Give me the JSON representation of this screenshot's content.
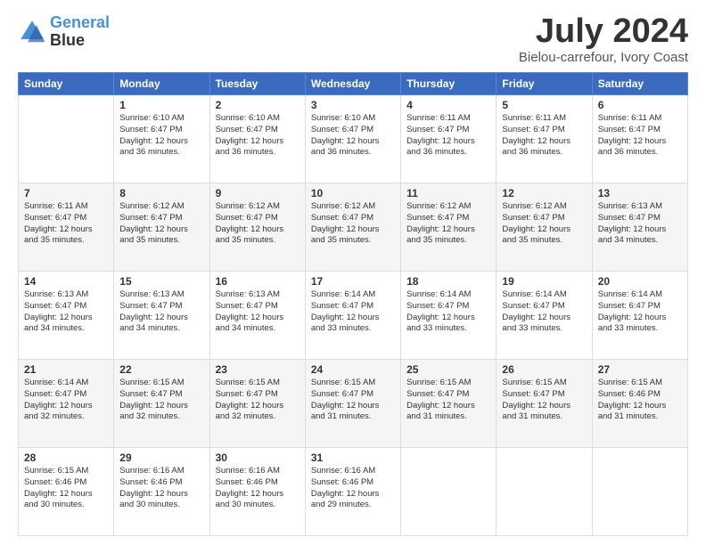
{
  "header": {
    "logo_line1": "General",
    "logo_line2": "Blue",
    "month": "July 2024",
    "location": "Bielou-carrefour, Ivory Coast"
  },
  "weekdays": [
    "Sunday",
    "Monday",
    "Tuesday",
    "Wednesday",
    "Thursday",
    "Friday",
    "Saturday"
  ],
  "weeks": [
    [
      {
        "day": "",
        "sunrise": "",
        "sunset": "",
        "daylight": ""
      },
      {
        "day": "1",
        "sunrise": "Sunrise: 6:10 AM",
        "sunset": "Sunset: 6:47 PM",
        "daylight": "Daylight: 12 hours and 36 minutes."
      },
      {
        "day": "2",
        "sunrise": "Sunrise: 6:10 AM",
        "sunset": "Sunset: 6:47 PM",
        "daylight": "Daylight: 12 hours and 36 minutes."
      },
      {
        "day": "3",
        "sunrise": "Sunrise: 6:10 AM",
        "sunset": "Sunset: 6:47 PM",
        "daylight": "Daylight: 12 hours and 36 minutes."
      },
      {
        "day": "4",
        "sunrise": "Sunrise: 6:11 AM",
        "sunset": "Sunset: 6:47 PM",
        "daylight": "Daylight: 12 hours and 36 minutes."
      },
      {
        "day": "5",
        "sunrise": "Sunrise: 6:11 AM",
        "sunset": "Sunset: 6:47 PM",
        "daylight": "Daylight: 12 hours and 36 minutes."
      },
      {
        "day": "6",
        "sunrise": "Sunrise: 6:11 AM",
        "sunset": "Sunset: 6:47 PM",
        "daylight": "Daylight: 12 hours and 36 minutes."
      }
    ],
    [
      {
        "day": "7",
        "sunrise": "Sunrise: 6:11 AM",
        "sunset": "Sunset: 6:47 PM",
        "daylight": "Daylight: 12 hours and 35 minutes."
      },
      {
        "day": "8",
        "sunrise": "Sunrise: 6:12 AM",
        "sunset": "Sunset: 6:47 PM",
        "daylight": "Daylight: 12 hours and 35 minutes."
      },
      {
        "day": "9",
        "sunrise": "Sunrise: 6:12 AM",
        "sunset": "Sunset: 6:47 PM",
        "daylight": "Daylight: 12 hours and 35 minutes."
      },
      {
        "day": "10",
        "sunrise": "Sunrise: 6:12 AM",
        "sunset": "Sunset: 6:47 PM",
        "daylight": "Daylight: 12 hours and 35 minutes."
      },
      {
        "day": "11",
        "sunrise": "Sunrise: 6:12 AM",
        "sunset": "Sunset: 6:47 PM",
        "daylight": "Daylight: 12 hours and 35 minutes."
      },
      {
        "day": "12",
        "sunrise": "Sunrise: 6:12 AM",
        "sunset": "Sunset: 6:47 PM",
        "daylight": "Daylight: 12 hours and 35 minutes."
      },
      {
        "day": "13",
        "sunrise": "Sunrise: 6:13 AM",
        "sunset": "Sunset: 6:47 PM",
        "daylight": "Daylight: 12 hours and 34 minutes."
      }
    ],
    [
      {
        "day": "14",
        "sunrise": "Sunrise: 6:13 AM",
        "sunset": "Sunset: 6:47 PM",
        "daylight": "Daylight: 12 hours and 34 minutes."
      },
      {
        "day": "15",
        "sunrise": "Sunrise: 6:13 AM",
        "sunset": "Sunset: 6:47 PM",
        "daylight": "Daylight: 12 hours and 34 minutes."
      },
      {
        "day": "16",
        "sunrise": "Sunrise: 6:13 AM",
        "sunset": "Sunset: 6:47 PM",
        "daylight": "Daylight: 12 hours and 34 minutes."
      },
      {
        "day": "17",
        "sunrise": "Sunrise: 6:14 AM",
        "sunset": "Sunset: 6:47 PM",
        "daylight": "Daylight: 12 hours and 33 minutes."
      },
      {
        "day": "18",
        "sunrise": "Sunrise: 6:14 AM",
        "sunset": "Sunset: 6:47 PM",
        "daylight": "Daylight: 12 hours and 33 minutes."
      },
      {
        "day": "19",
        "sunrise": "Sunrise: 6:14 AM",
        "sunset": "Sunset: 6:47 PM",
        "daylight": "Daylight: 12 hours and 33 minutes."
      },
      {
        "day": "20",
        "sunrise": "Sunrise: 6:14 AM",
        "sunset": "Sunset: 6:47 PM",
        "daylight": "Daylight: 12 hours and 33 minutes."
      }
    ],
    [
      {
        "day": "21",
        "sunrise": "Sunrise: 6:14 AM",
        "sunset": "Sunset: 6:47 PM",
        "daylight": "Daylight: 12 hours and 32 minutes."
      },
      {
        "day": "22",
        "sunrise": "Sunrise: 6:15 AM",
        "sunset": "Sunset: 6:47 PM",
        "daylight": "Daylight: 12 hours and 32 minutes."
      },
      {
        "day": "23",
        "sunrise": "Sunrise: 6:15 AM",
        "sunset": "Sunset: 6:47 PM",
        "daylight": "Daylight: 12 hours and 32 minutes."
      },
      {
        "day": "24",
        "sunrise": "Sunrise: 6:15 AM",
        "sunset": "Sunset: 6:47 PM",
        "daylight": "Daylight: 12 hours and 31 minutes."
      },
      {
        "day": "25",
        "sunrise": "Sunrise: 6:15 AM",
        "sunset": "Sunset: 6:47 PM",
        "daylight": "Daylight: 12 hours and 31 minutes."
      },
      {
        "day": "26",
        "sunrise": "Sunrise: 6:15 AM",
        "sunset": "Sunset: 6:47 PM",
        "daylight": "Daylight: 12 hours and 31 minutes."
      },
      {
        "day": "27",
        "sunrise": "Sunrise: 6:15 AM",
        "sunset": "Sunset: 6:46 PM",
        "daylight": "Daylight: 12 hours and 31 minutes."
      }
    ],
    [
      {
        "day": "28",
        "sunrise": "Sunrise: 6:15 AM",
        "sunset": "Sunset: 6:46 PM",
        "daylight": "Daylight: 12 hours and 30 minutes."
      },
      {
        "day": "29",
        "sunrise": "Sunrise: 6:16 AM",
        "sunset": "Sunset: 6:46 PM",
        "daylight": "Daylight: 12 hours and 30 minutes."
      },
      {
        "day": "30",
        "sunrise": "Sunrise: 6:16 AM",
        "sunset": "Sunset: 6:46 PM",
        "daylight": "Daylight: 12 hours and 30 minutes."
      },
      {
        "day": "31",
        "sunrise": "Sunrise: 6:16 AM",
        "sunset": "Sunset: 6:46 PM",
        "daylight": "Daylight: 12 hours and 29 minutes."
      },
      {
        "day": "",
        "sunrise": "",
        "sunset": "",
        "daylight": ""
      },
      {
        "day": "",
        "sunrise": "",
        "sunset": "",
        "daylight": ""
      },
      {
        "day": "",
        "sunrise": "",
        "sunset": "",
        "daylight": ""
      }
    ]
  ]
}
